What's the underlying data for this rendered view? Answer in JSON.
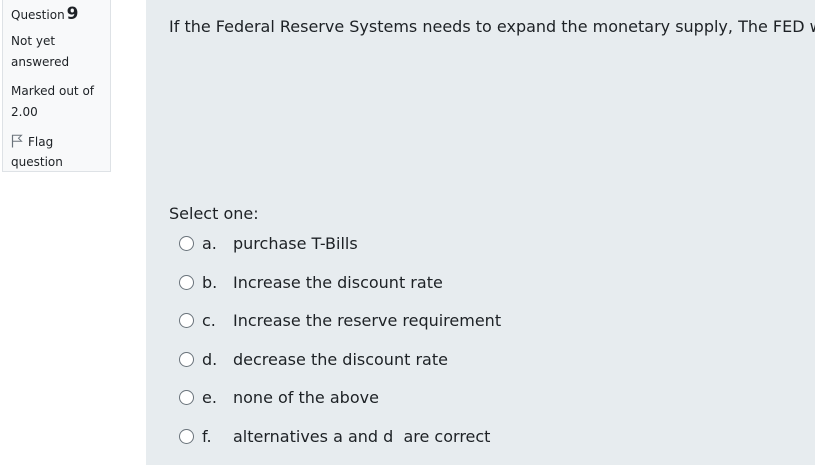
{
  "info": {
    "question_label": "Question",
    "question_number": "9",
    "state": "Not yet answered",
    "grade": "Marked out of 2.00",
    "flag_label": "Flag question"
  },
  "question": {
    "text": "If the Federal Reserve Systems needs to expand the monetary supply, The FED will:",
    "prompt": "Select one:",
    "options": [
      {
        "letter": "a.",
        "text": "purchase T-Bills"
      },
      {
        "letter": "b.",
        "text": "Increase the discount rate"
      },
      {
        "letter": "c.",
        "text": "Increase the reserve requirement"
      },
      {
        "letter": "d.",
        "text": "decrease the discount rate"
      },
      {
        "letter": "e.",
        "text": "none of the above"
      },
      {
        "letter": "f.",
        "text": "alternatives a and d  are correct"
      }
    ]
  },
  "colors": {
    "content_background": "#e7ecef",
    "info_background": "#f8f9fa",
    "text": "#1d2125"
  },
  "icons": {
    "flag": "flag-icon"
  }
}
